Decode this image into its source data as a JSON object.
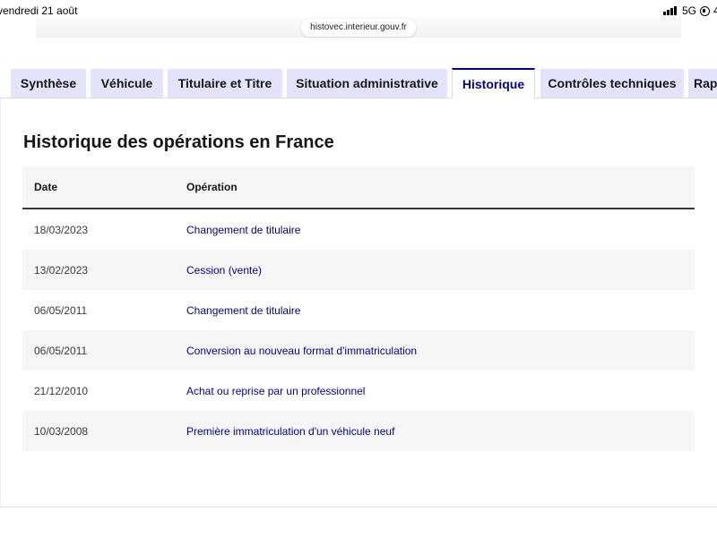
{
  "status_bar": {
    "time": "vendredi 21 août",
    "network": "5G",
    "battery_fragment": "4:"
  },
  "browser": {
    "url": "histovec.interieur.gouv.fr"
  },
  "tabs": [
    {
      "label": "Synthèse",
      "active": false
    },
    {
      "label": "Véhicule",
      "active": false
    },
    {
      "label": "Titulaire et Titre",
      "active": false
    },
    {
      "label": "Situation administrative",
      "active": false
    },
    {
      "label": "Historique",
      "active": true
    },
    {
      "label": "Contrôles techniques",
      "active": false
    },
    {
      "label": "Rap",
      "active": false
    }
  ],
  "section": {
    "title": "Historique des opérations en France"
  },
  "table": {
    "headers": {
      "date": "Date",
      "operation": "Opération"
    },
    "rows": [
      {
        "date": "18/03/2023",
        "operation": "Changement de titulaire"
      },
      {
        "date": "13/02/2023",
        "operation": "Cession (vente)"
      },
      {
        "date": "06/05/2011",
        "operation": "Changement de titulaire"
      },
      {
        "date": "06/05/2011",
        "operation": "Conversion au nouveau format d'immatriculation"
      },
      {
        "date": "21/12/2010",
        "operation": "Achat ou reprise par un professionnel"
      },
      {
        "date": "10/03/2008",
        "operation": "Première immatriculation d'un véhicule neuf"
      }
    ]
  },
  "colors": {
    "accent": "#000091",
    "tab_background": "#e3e3fd",
    "row_alt": "#f6f6f6"
  }
}
